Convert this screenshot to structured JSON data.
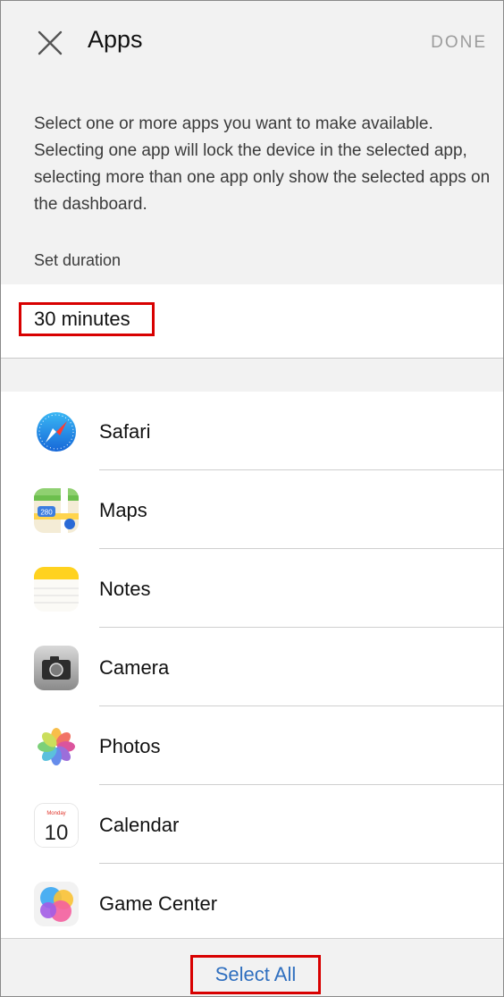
{
  "header": {
    "title": "Apps",
    "done_label": "DONE"
  },
  "description": "Select one or more apps you want to make available. Selecting one app will lock the device in the selected app, selecting more than one app only show the selected apps on the dashboard.",
  "duration": {
    "label": "Set duration",
    "value": "30 minutes"
  },
  "apps": [
    {
      "name": "Safari",
      "icon": "safari-icon"
    },
    {
      "name": "Maps",
      "icon": "maps-icon"
    },
    {
      "name": "Notes",
      "icon": "notes-icon"
    },
    {
      "name": "Camera",
      "icon": "camera-icon"
    },
    {
      "name": "Photos",
      "icon": "photos-icon"
    },
    {
      "name": "Calendar",
      "icon": "calendar-icon",
      "icon_text": {
        "day_name": "Monday",
        "day_number": "10"
      }
    },
    {
      "name": "Game Center",
      "icon": "game-center-icon"
    }
  ],
  "maps_icon_text": {
    "shield": "280"
  },
  "footer": {
    "select_all_label": "Select All"
  },
  "colors": {
    "accent_blue": "#2f6fbf",
    "highlight_red": "#d80000",
    "background_gray": "#f2f2f2"
  }
}
